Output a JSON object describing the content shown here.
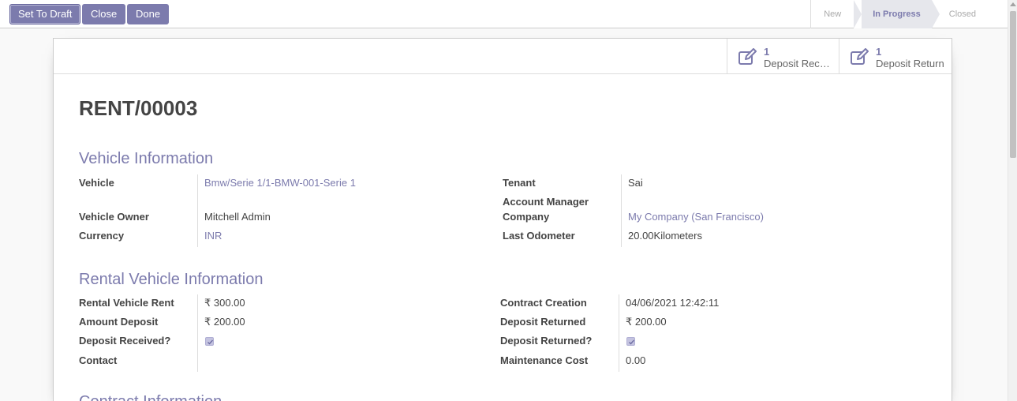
{
  "toolbar": {
    "set_to_draft": "Set To Draft",
    "close": "Close",
    "done": "Done"
  },
  "statusbar": {
    "steps": [
      "New",
      "In Progress",
      "Closed"
    ],
    "active": "In Progress"
  },
  "smart_buttons": [
    {
      "value": "1",
      "label": "Deposit Received",
      "icon": "edit-icon"
    },
    {
      "value": "1",
      "label": "Deposit Return",
      "icon": "edit-icon"
    }
  ],
  "record": {
    "title": "RENT/00003"
  },
  "vehicle_info": {
    "heading": "Vehicle Information",
    "vehicle_label": "Vehicle",
    "vehicle_value": "Bmw/Serie 1/1-BMW-001-Serie 1",
    "owner_label": "Vehicle Owner",
    "owner_value": "Mitchell Admin",
    "currency_label": "Currency",
    "currency_value": "INR",
    "tenant_label": "Tenant",
    "tenant_value": "Sai",
    "account_manager_label": "Account Manager",
    "company_label": "Company",
    "company_value": "My Company (San Francisco)",
    "odometer_label": "Last Odometer",
    "odometer_value": "20.00Kilometers"
  },
  "rental_info": {
    "heading": "Rental Vehicle Information",
    "rent_label": "Rental Vehicle Rent",
    "rent_value": "₹ 300.00",
    "deposit_label": "Amount Deposit",
    "deposit_value": "₹ 200.00",
    "deposit_received_label": "Deposit Received?",
    "deposit_received_checked": true,
    "contact_label": "Contact",
    "contact_value": "",
    "creation_label": "Contract Creation",
    "creation_value": "04/06/2021 12:42:11",
    "returned_amount_label": "Deposit Returned",
    "returned_amount_value": "₹ 200.00",
    "deposit_returned_label": "Deposit Returned?",
    "deposit_returned_checked": true,
    "maintenance_label": "Maintenance Cost",
    "maintenance_value": "0.00"
  },
  "contract_info": {
    "heading": "Contract Information"
  },
  "colors": {
    "accent": "#7c7bad",
    "text": "#444444",
    "border": "#dddddd"
  }
}
